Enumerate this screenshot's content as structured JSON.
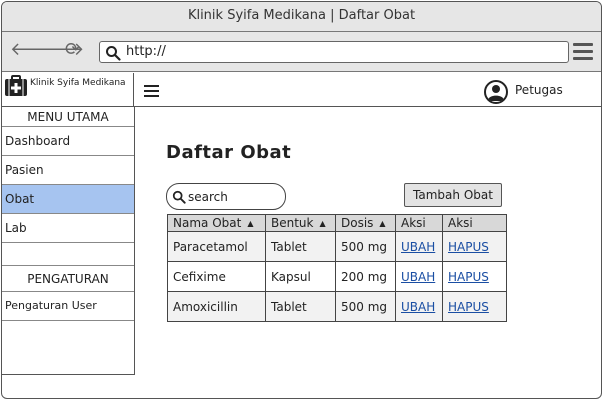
{
  "window": {
    "title": "Klinik Syifa Medikana | Daftar Obat"
  },
  "browser": {
    "url": "http://",
    "icons": {
      "back": "arrow-left-icon",
      "forward": "arrow-right-icon",
      "reload": "reload-icon",
      "search": "search-icon",
      "menu": "hamburger-menu-icon"
    }
  },
  "header": {
    "brand_name": "Klinik Syifa Medikana",
    "logo_icon": "medical-kit-icon",
    "user_label": "Petugas",
    "user_icon": "user-avatar-icon"
  },
  "sidebar": {
    "menu_title": "MENU UTAMA",
    "items": [
      {
        "label": "Dashboard",
        "active": false
      },
      {
        "label": "Pasien",
        "active": false
      },
      {
        "label": "Obat",
        "active": true
      },
      {
        "label": "Lab",
        "active": false
      }
    ],
    "settings_title": "PENGATURAN",
    "settings_items": [
      {
        "label": "Pengaturan User"
      }
    ],
    "active_color": "#a6c4f0"
  },
  "main": {
    "title": "Daftar Obat",
    "search_placeholder": "search",
    "add_button": "Tambah Obat",
    "table": {
      "headers": [
        "Nama Obat",
        "Bentuk",
        "Dosis",
        "Aksi",
        "Aksi"
      ],
      "rows": [
        {
          "nama": "Paracetamol",
          "bentuk": "Tablet",
          "dosis": "500 mg",
          "edit": "UBAH",
          "delete": "HAPUS"
        },
        {
          "nama": "Cefixime",
          "bentuk": "Kapsul",
          "dosis": "200 mg",
          "edit": "UBAH",
          "delete": "HAPUS"
        },
        {
          "nama": "Amoxicillin",
          "bentuk": "Tablet",
          "dosis": "500 mg",
          "edit": "UBAH",
          "delete": "HAPUS"
        }
      ],
      "link_color": "#1a4ea3"
    }
  }
}
